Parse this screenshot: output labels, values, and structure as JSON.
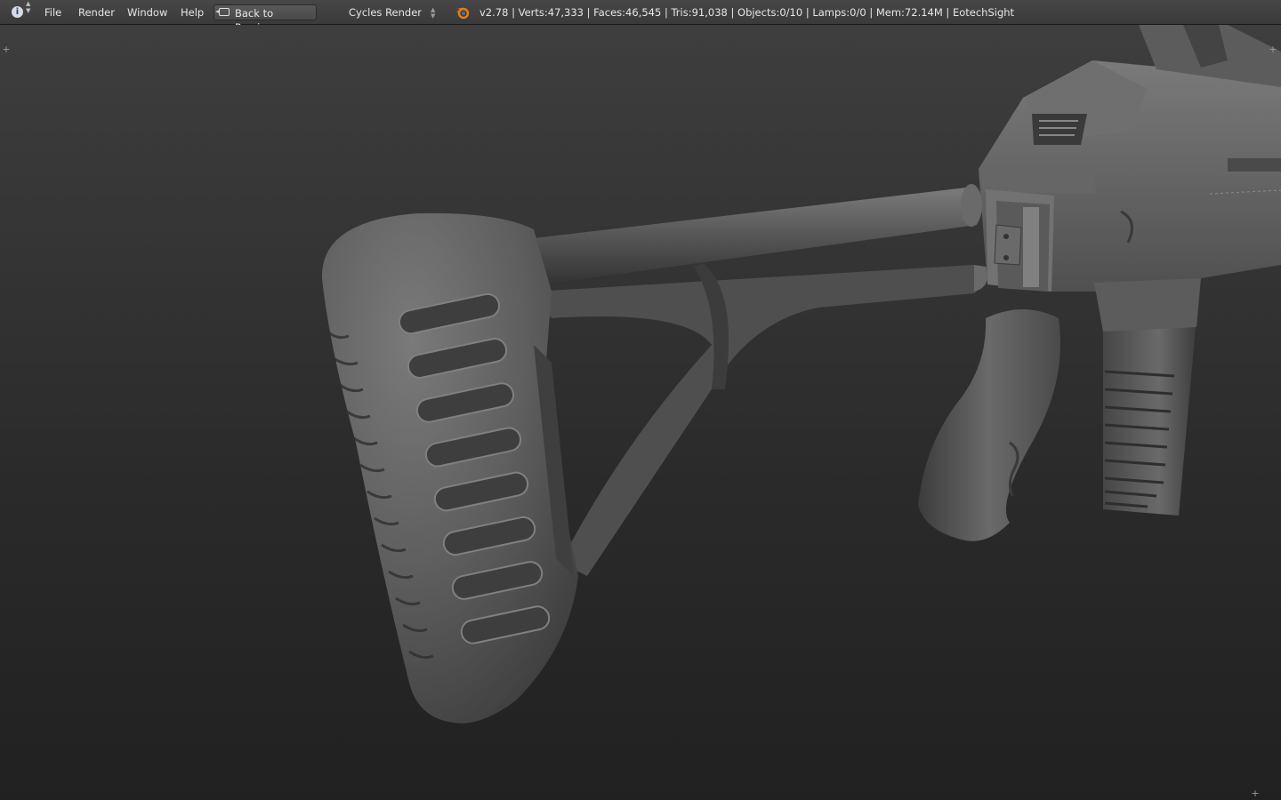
{
  "header": {
    "menus": [
      "File",
      "Render",
      "Window",
      "Help"
    ],
    "back_button": "Back to Previous",
    "render_engine": "Cycles Render",
    "stats": "v2.78 | Verts:47,333 | Faces:46,545 | Tris:91,038 | Objects:0/10 | Lamps:0/0 | Mem:72.14M | EotechSight"
  },
  "icons": {
    "editor_type": "info-icon",
    "back": "back-icon",
    "logo": "blender-logo-icon",
    "corners": "plus-icon"
  },
  "colors": {
    "header_bg": "#3f3f3f",
    "viewport_top": "#3e3e3e",
    "viewport_bottom": "#212121",
    "model": "#5a5a5a",
    "logo_orange": "#e87d0d"
  }
}
